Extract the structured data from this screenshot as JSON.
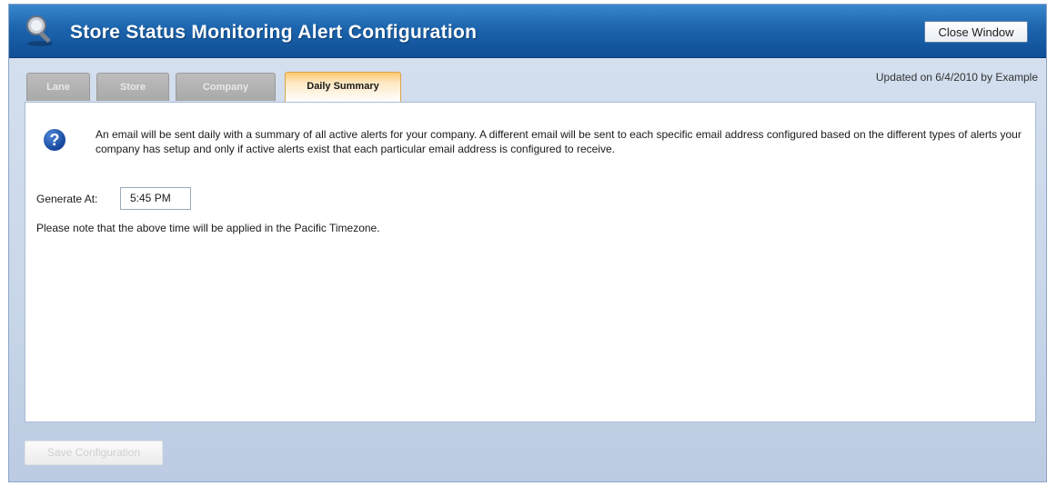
{
  "window": {
    "title": "Store Status Monitoring Alert Configuration",
    "close_label": "Close Window"
  },
  "tabs": [
    {
      "label": "Lane",
      "active": false
    },
    {
      "label": "Store",
      "active": false
    },
    {
      "label": "Company",
      "active": false
    },
    {
      "label": "Daily Summary",
      "active": true
    }
  ],
  "updated_text": "Updated on 6/4/2010 by Example",
  "panel": {
    "info_text": "An email will be sent daily with a summary of all active alerts for your company. A different email will be sent to each specific email address configured based on the different types of alerts your company has setup and only if active alerts exist that each particular email address is configured to receive.",
    "generate_label": "Generate At:",
    "generate_value": "5:45 PM",
    "timezone_note": "Please note that the above time will be applied in the Pacific Timezone."
  },
  "save_label": "Save Configuration",
  "icons": {
    "app": "magnifier-wrench-icon",
    "help": "question-icon"
  },
  "colors": {
    "titlebar": "#1c64ad",
    "active_tab": "#ffc870",
    "inactive_tab": "#b3b3b3"
  }
}
